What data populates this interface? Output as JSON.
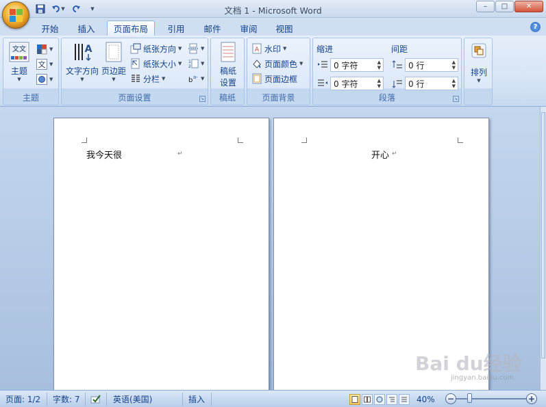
{
  "window": {
    "title": "文档 1 - Microsoft Word",
    "minimize": "–",
    "maximize": "□",
    "close": "✕"
  },
  "tabs": [
    {
      "label": "开始"
    },
    {
      "label": "插入"
    },
    {
      "label": "页面布局",
      "active": true
    },
    {
      "label": "引用"
    },
    {
      "label": "邮件"
    },
    {
      "label": "审阅"
    },
    {
      "label": "视图"
    }
  ],
  "help": "?",
  "ribbon": {
    "theme_group": {
      "name": "主题",
      "theme_label": "主题"
    },
    "page_setup_group": {
      "name": "页面设置",
      "text_direction": "文字方向",
      "margins": "页边距",
      "orientation": "纸张方向",
      "size": "纸张大小",
      "columns": "分栏"
    },
    "manuscript_group": {
      "name": "稿纸",
      "label_line1": "稿纸",
      "label_line2": "设置"
    },
    "background_group": {
      "name": "页面背景",
      "watermark": "水印",
      "page_color": "页面颜色",
      "page_borders": "页面边框"
    },
    "paragraph_group": {
      "name": "段落",
      "indent_label": "缩进",
      "spacing_label": "间距",
      "indent_left": "0 字符",
      "indent_right": "0 字符",
      "spacing_before": "0 行",
      "spacing_after": "0 行"
    },
    "arrange_group": {
      "label": "排列"
    }
  },
  "document": {
    "page1_text": "我今天很",
    "page2_text": "开心",
    "para_mark": "↵"
  },
  "status": {
    "page": "页面: 1/2",
    "words": "字数: 7",
    "language": "英语(美国)",
    "mode": "插入",
    "zoom": "40%",
    "zoom_level": 0.4
  },
  "watermark": {
    "brand": "Bai du经验",
    "url": "jingyan.baidu.com"
  },
  "colors": {
    "accent": "#15428b",
    "ribbon": "#dde9f8",
    "workspace": "#abc3e0"
  }
}
